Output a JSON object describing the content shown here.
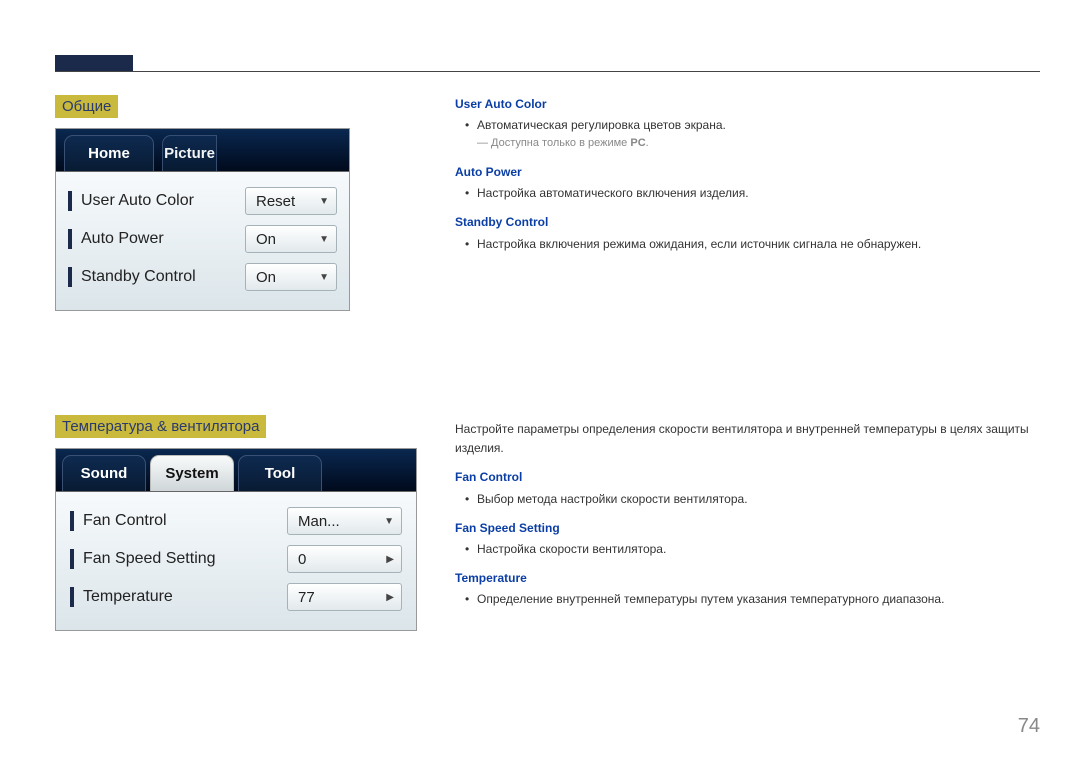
{
  "page_number": "74",
  "section1": {
    "title": "Общие",
    "tabs": [
      "Home",
      "Picture"
    ],
    "active_tab": 0,
    "menu": [
      {
        "label": "User Auto Color",
        "value": "Reset"
      },
      {
        "label": "Auto Power",
        "value": "On"
      },
      {
        "label": "Standby Control",
        "value": "On"
      }
    ]
  },
  "section2": {
    "title": "Температура & вентилятора",
    "tabs": [
      "Sound",
      "System",
      "Tool"
    ],
    "active_tab": 1,
    "menu": [
      {
        "label": "Fan Control",
        "value": "Man..."
      },
      {
        "label": "Fan Speed Setting",
        "value": "0"
      },
      {
        "label": "Temperature",
        "value": "77"
      }
    ]
  },
  "desc1": {
    "items": [
      {
        "head": "User Auto Color",
        "bullets": [
          "Автоматическая регулировка цветов экрана."
        ],
        "note_prefix": "Доступна только в режиме ",
        "note_bold": "PC",
        "note_suffix": "."
      },
      {
        "head": "Auto Power",
        "bullets": [
          "Настройка автоматического включения изделия."
        ]
      },
      {
        "head": "Standby Control",
        "bullets": [
          "Настройка включения режима ожидания, если источник сигнала не обнаружен."
        ]
      }
    ]
  },
  "desc2": {
    "intro": "Настройте параметры определения скорости вентилятора и внутренней температуры в целях защиты изделия.",
    "items": [
      {
        "head": "Fan Control",
        "bullets": [
          "Выбор метода настройки скорости вентилятора."
        ]
      },
      {
        "head": "Fan Speed Setting",
        "bullets": [
          "Настройка скорости вентилятора."
        ]
      },
      {
        "head": "Temperature",
        "bullets": [
          "Определение внутренней температуры путем указания температурного диапазона."
        ]
      }
    ]
  }
}
